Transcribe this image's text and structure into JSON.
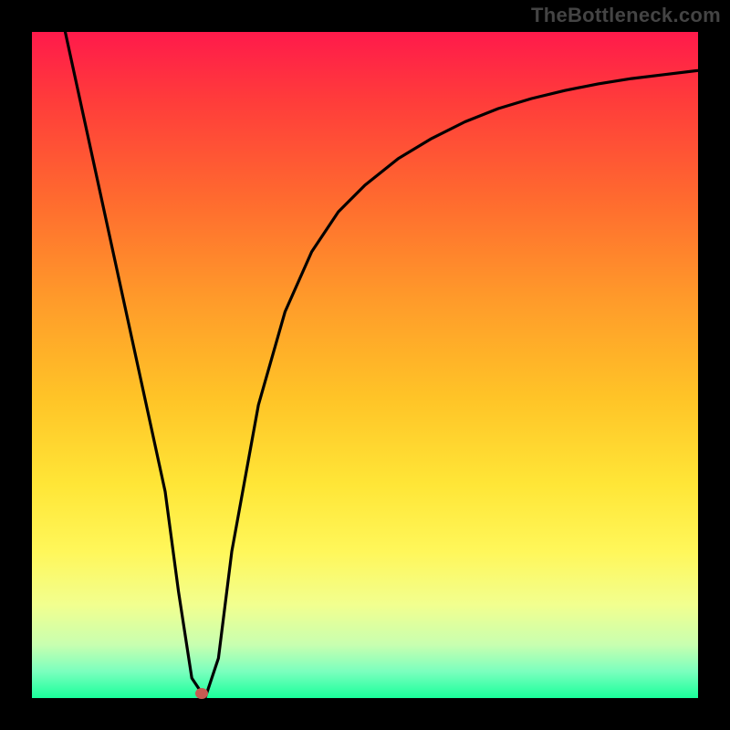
{
  "watermark": "TheBottleneck.com",
  "chart_data": {
    "type": "line",
    "title": "",
    "xlabel": "",
    "ylabel": "",
    "xlim": [
      0,
      100
    ],
    "ylim": [
      0,
      100
    ],
    "grid": false,
    "series": [
      {
        "name": "curve",
        "x": [
          5,
          10,
          15,
          20,
          22,
          24,
          26,
          28,
          30,
          34,
          38,
          42,
          46,
          50,
          55,
          60,
          65,
          70,
          75,
          80,
          85,
          90,
          95,
          100
        ],
        "y": [
          100,
          77,
          54,
          31,
          16,
          3,
          0,
          6,
          22,
          44,
          58,
          67,
          73,
          77,
          81,
          84,
          86.5,
          88.5,
          90,
          91.2,
          92.2,
          93,
          93.6,
          94.2
        ]
      }
    ],
    "marker": {
      "x": 25.5,
      "y": 0.7,
      "color": "#c65a52"
    },
    "background_gradient": {
      "top": "#ff1a4b",
      "bottom": "#19ff9b"
    }
  }
}
